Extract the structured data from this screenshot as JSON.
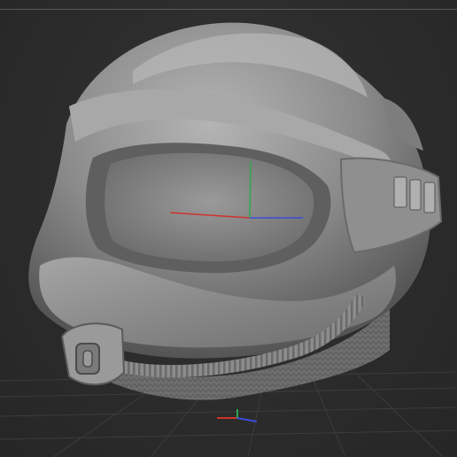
{
  "viewport": {
    "background_color": "#2d2d2d",
    "grid_color": "#3c3c3c",
    "model": "helmet-sculpt",
    "model_material_color": "#8e8e8e",
    "gizmo_colors": {
      "x_axis": "#d0342c",
      "y_axis": "#2fa84f",
      "z_axis": "#3a4fd8"
    }
  }
}
